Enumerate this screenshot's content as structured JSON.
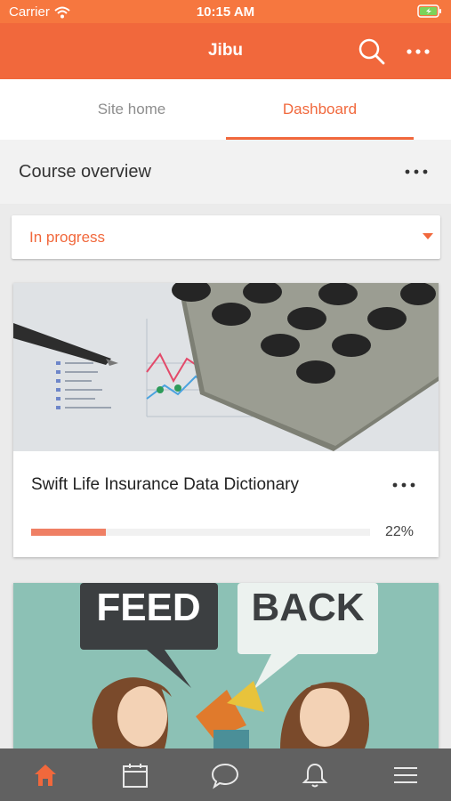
{
  "status_bar": {
    "carrier": "Carrier",
    "time": "10:15 AM"
  },
  "header": {
    "title": "Jibu",
    "icons": [
      "search-icon",
      "more-icon"
    ]
  },
  "tabs": [
    {
      "label": "Site home",
      "active": false
    },
    {
      "label": "Dashboard",
      "active": true
    }
  ],
  "course_overview": {
    "title": "Course overview",
    "filter": {
      "selected": "In progress"
    },
    "courses": [
      {
        "name": "Swift Life Insurance Data Dictionary",
        "progress": 22,
        "progress_text": "22%",
        "image": "calculator-chart-image"
      },
      {
        "name": "",
        "image": "feedback-image",
        "image_text": [
          "FEED",
          "BACK"
        ]
      }
    ]
  },
  "bottom_tabs": [
    "home-icon",
    "calendar-icon",
    "messages-icon",
    "notifications-icon",
    "menu-icon"
  ],
  "colors": {
    "accent": "#f1683c",
    "status_bar": "#f6773f",
    "tabbar": "#616161",
    "progress": "#ef7f64"
  }
}
